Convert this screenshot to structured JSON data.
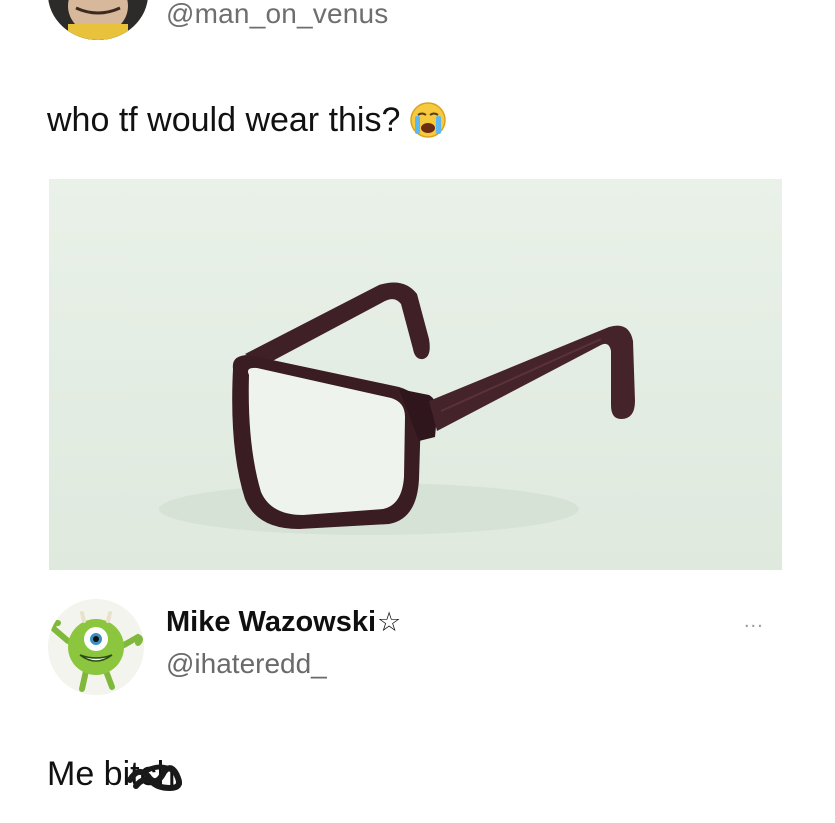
{
  "top_post": {
    "handle": "@man_on_venus",
    "text": "who tf would wear this?",
    "emoji": "loudly-crying-face-icon"
  },
  "media": {
    "image": "glasses-photo"
  },
  "reply": {
    "display_name": "Mike Wazowski",
    "badge": "☆",
    "handle": "@ihateredd_",
    "more_label": "...",
    "text": "Me bitch."
  },
  "colors": {
    "background": "#ffffff",
    "photo_bg": "#e4eee3",
    "frame": "#3b1f26",
    "handle_gray": "#6e6e6e"
  }
}
